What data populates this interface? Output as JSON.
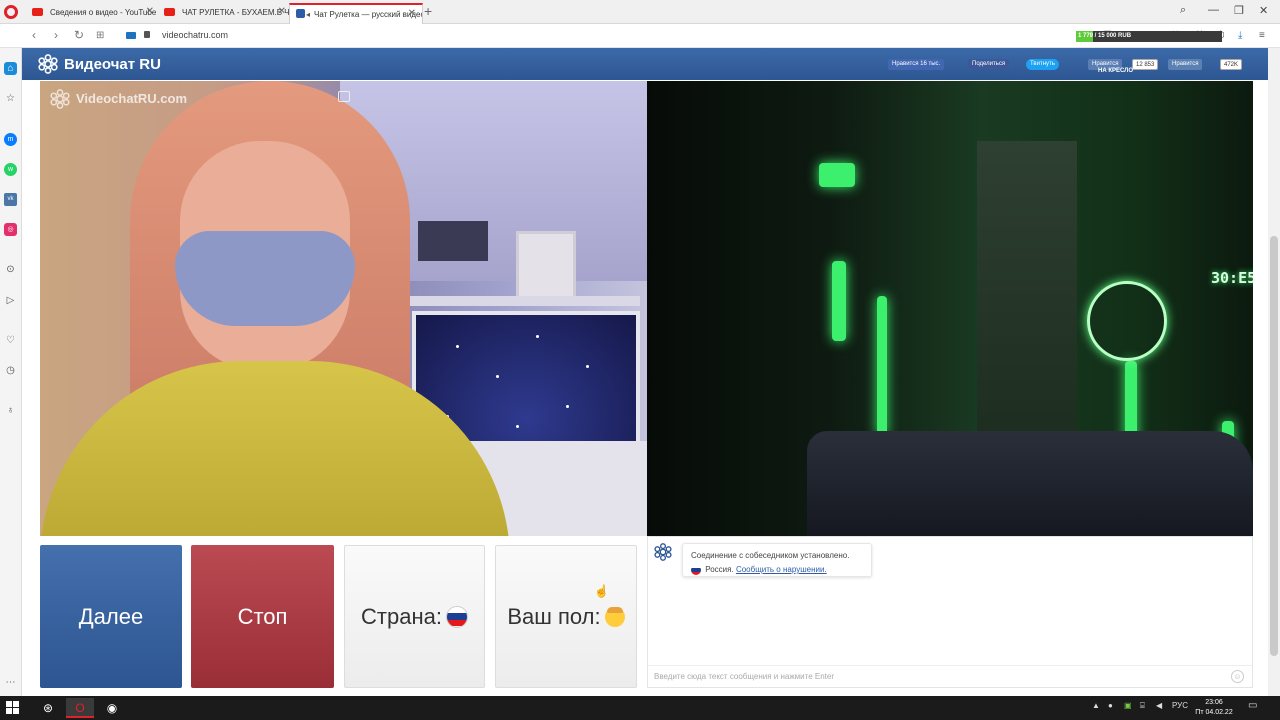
{
  "browser": {
    "tabs": [
      {
        "title": "Сведения о видео - YouTube"
      },
      {
        "title": "ЧАТ РУЛЕТКА - БУХАЕМ.В ЧАТ"
      },
      {
        "title": "Чат Рулетка — русский видеочат"
      }
    ],
    "url": "videochatru.com"
  },
  "site": {
    "title": "Видеочат RU",
    "social": {
      "like_fb": "Нравится 16 тыс.",
      "share": "Поделиться",
      "tweet": "Твитнуть",
      "like_ok": "Нравится",
      "ok_count": "12 853",
      "like_vk": "Нравится",
      "vk_count": "472K"
    },
    "promo": {
      "label": "НА КРЕСЛО",
      "progress_text": "1 779 / 15 000 RUB",
      "progress_fraction": 0.1186
    }
  },
  "video": {
    "watermark": "VideochatRU.com",
    "clock": "30:E5"
  },
  "controls": {
    "next": "Далее",
    "stop": "Стоп",
    "country": "Страна:",
    "gender": "Ваш пол:"
  },
  "chat": {
    "message": "Соединение с собеседником установлено.",
    "country": "Россия.",
    "report": "Сообщить о нарушении.",
    "placeholder": "Введите сюда текст сообщения и нажмите Enter"
  },
  "taskbar": {
    "lang": "РУС",
    "time": "23:06",
    "date": "Пт 04.02.22"
  },
  "colors": {
    "brand": "#2d5793",
    "next": "#3a65a3",
    "stop": "#aa3b44"
  }
}
